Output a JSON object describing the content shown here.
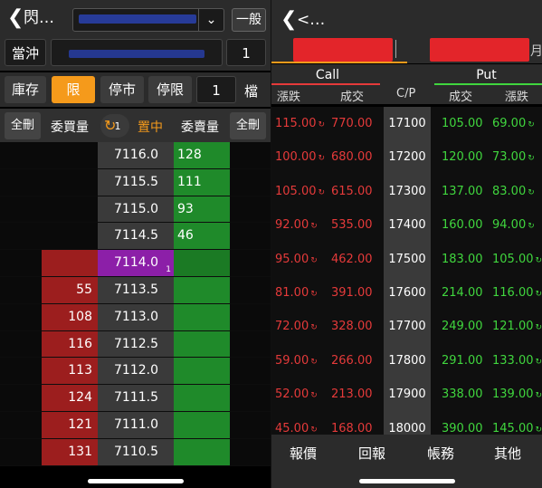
{
  "left": {
    "title": "閃…",
    "symbol_dropdown_icon": "chevron-down-icon",
    "mode_button": "一般",
    "row2": {
      "daytrade": "當沖",
      "quantity": "1"
    },
    "row3": {
      "inventory": "庫存",
      "limit": "限",
      "stop_market": "停市",
      "stop_limit": "停限",
      "ticks_value": "1",
      "ticks_label": "檔"
    },
    "row4": {
      "cancel_all_left": "全刪",
      "bid_qty": "委買量",
      "center_icon": "recenter-icon",
      "center_badge": "1",
      "center_label": "置中",
      "ask_qty": "委賣量",
      "cancel_all_right": "全刪"
    },
    "orderbook": [
      {
        "bid": "",
        "price": "7116.0",
        "ask": "128"
      },
      {
        "bid": "",
        "price": "7115.5",
        "ask": "111"
      },
      {
        "bid": "",
        "price": "7115.0",
        "ask": "93"
      },
      {
        "bid": "",
        "price": "7114.5",
        "ask": "46"
      },
      {
        "bid": "",
        "price": "7114.0",
        "ask": "",
        "last_badge": "1"
      },
      {
        "bid": "55",
        "price": "7113.5",
        "ask": ""
      },
      {
        "bid": "108",
        "price": "7113.0",
        "ask": ""
      },
      {
        "bid": "116",
        "price": "7112.5",
        "ask": ""
      },
      {
        "bid": "113",
        "price": "7112.0",
        "ask": ""
      },
      {
        "bid": "124",
        "price": "7111.5",
        "ask": ""
      },
      {
        "bid": "121",
        "price": "7111.0",
        "ask": ""
      },
      {
        "bid": "131",
        "price": "7110.5",
        "ask": ""
      }
    ]
  },
  "right": {
    "title": "<…",
    "tab_suffix": "月",
    "call_label": "Call",
    "put_label": "Put",
    "columns": {
      "call_change": "漲跌",
      "call_volume": "成交",
      "strike": "C/P",
      "put_volume": "成交",
      "put_change": "漲跌"
    },
    "options": [
      {
        "call_change": "115.00",
        "call_volume": "770.00",
        "strike": "17100",
        "put_volume": "105.00",
        "put_change": "69.00"
      },
      {
        "call_change": "100.00",
        "call_volume": "680.00",
        "strike": "17200",
        "put_volume": "120.00",
        "put_change": "73.00"
      },
      {
        "call_change": "105.00",
        "call_volume": "615.00",
        "strike": "17300",
        "put_volume": "137.00",
        "put_change": "83.00"
      },
      {
        "call_change": "92.00",
        "call_volume": "535.00",
        "strike": "17400",
        "put_volume": "160.00",
        "put_change": "94.00"
      },
      {
        "call_change": "95.00",
        "call_volume": "462.00",
        "strike": "17500",
        "put_volume": "183.00",
        "put_change": "105.00"
      },
      {
        "call_change": "81.00",
        "call_volume": "391.00",
        "strike": "17600",
        "put_volume": "214.00",
        "put_change": "116.00"
      },
      {
        "call_change": "72.00",
        "call_volume": "328.00",
        "strike": "17700",
        "put_volume": "249.00",
        "put_change": "121.00"
      },
      {
        "call_change": "59.00",
        "call_volume": "266.00",
        "strike": "17800",
        "put_volume": "291.00",
        "put_change": "133.00"
      },
      {
        "call_change": "52.00",
        "call_volume": "213.00",
        "strike": "17900",
        "put_volume": "338.00",
        "put_change": "139.00"
      },
      {
        "call_change": "45.00",
        "call_volume": "168.00",
        "strike": "18000",
        "put_volume": "390.00",
        "put_change": "145.00"
      }
    ],
    "bottom_nav": [
      "報價",
      "回報",
      "帳務",
      "其他"
    ]
  },
  "colors": {
    "accent_orange": "#f59a1b",
    "bid_red": "#9c1e1e",
    "ask_green": "#1f8a2a",
    "last_purple": "#8c1fa8",
    "call_red": "#e53a3a",
    "put_green": "#40d63e"
  }
}
